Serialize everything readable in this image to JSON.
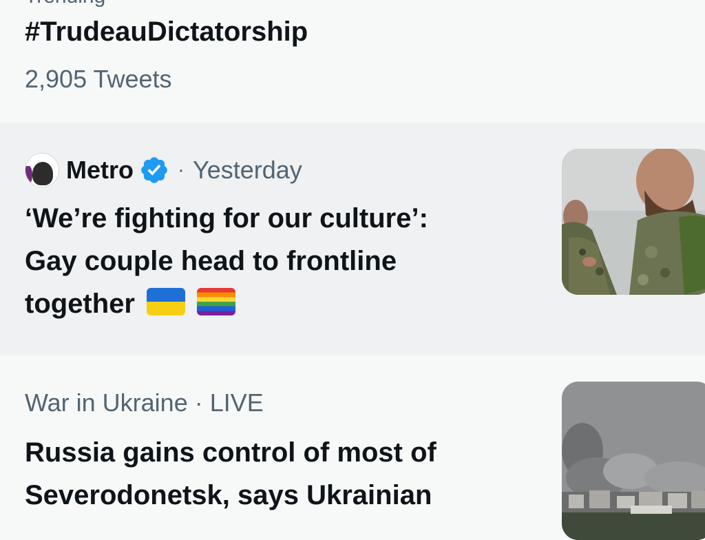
{
  "trend": {
    "context": "Trending",
    "title": "#TrudeauDictatorship",
    "tweet_count": "2,905 Tweets"
  },
  "news_item_1": {
    "source": "Metro",
    "separator": "·",
    "time": "Yesterday",
    "headline_line1": "‘We’re fighting for our culture’:",
    "headline_line2": "Gay couple head to frontline",
    "headline_line3": "together",
    "emoji": [
      "ukraine-flag",
      "rainbow-flag"
    ]
  },
  "news_item_2": {
    "topic": "War in Ukraine",
    "separator": "·",
    "status": "LIVE",
    "headline_line1": "Russia gains control of most of",
    "headline_line2": "Severodonetsk, says Ukrainian"
  },
  "colors": {
    "background": "#f7f9f9",
    "hover_background": "#eff1f2",
    "primary_text": "#0f1419",
    "secondary_text": "#536471",
    "verified_blue": "#1d9bf0"
  }
}
